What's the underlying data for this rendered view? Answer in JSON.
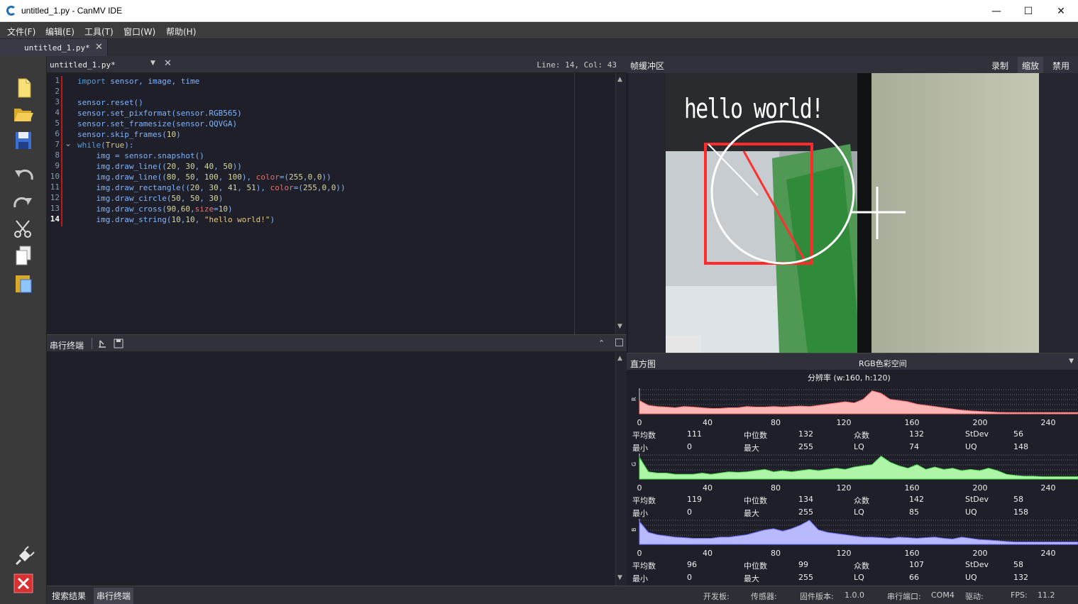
{
  "window": {
    "title": "untitled_1.py - CanMV IDE"
  },
  "menu": [
    "文件(F)",
    "编辑(E)",
    "工具(T)",
    "窗口(W)",
    "帮助(H)"
  ],
  "tab": {
    "label": "untitled_1.py*"
  },
  "editor": {
    "filename": "untitled_1.py*",
    "position": "Line: 14, Col: 43",
    "line_numbers": [
      "1",
      "2",
      "3",
      "4",
      "5",
      "6",
      "7",
      "8",
      "9",
      "10",
      "11",
      "12",
      "13",
      "14"
    ],
    "code_lines": [
      "import sensor, image, time",
      "",
      "sensor.reset()",
      "sensor.set_pixformat(sensor.RGB565)",
      "sensor.set_framesize(sensor.QQVGA)",
      "sensor.skip_frames(10)",
      "while(True):",
      "    img = sensor.snapshot()",
      "    img.draw_line((20, 30, 40, 50))",
      "    img.draw_line((80, 50, 100, 100), color=(255,0,0))",
      "    img.draw_rectangle((20, 30, 41, 51), color=(255,0,0))",
      "    img.draw_circle(50, 50, 30)",
      "    img.draw_cross(90,60,size=10)",
      "    img.draw_string(10,10, \"hello world!\")"
    ]
  },
  "terminal": {
    "title": "串行终端"
  },
  "framebuffer": {
    "title": "帧缓冲区",
    "buttons": [
      "录制",
      "缩放",
      "禁用"
    ],
    "overlay_text": "hello world!"
  },
  "histogram": {
    "title": "直方图",
    "colorspace": "RGB色彩空间",
    "resolution": "分辨率 (w:160, h:120)",
    "ticks": [
      "0",
      "40",
      "80",
      "120",
      "160",
      "200",
      "240"
    ],
    "channels": [
      {
        "axis": "R",
        "color": "#ffb6b6",
        "line": "#ff7070",
        "stats": {
          "平均数": "111",
          "中位数": "132",
          "众数": "132",
          "StDev": "56",
          "最小": "0",
          "最大": "255",
          "LQ": "74",
          "UQ": "148"
        }
      },
      {
        "axis": "G",
        "color": "#aef5a8",
        "line": "#4fd84f",
        "stats": {
          "平均数": "119",
          "中位数": "134",
          "众数": "142",
          "StDev": "58",
          "最小": "0",
          "最大": "255",
          "LQ": "85",
          "UQ": "158"
        }
      },
      {
        "axis": "B",
        "color": "#b9b9ff",
        "line": "#6f6fff",
        "stats": {
          "平均数": "96",
          "中位数": "99",
          "众数": "107",
          "StDev": "58",
          "最小": "0",
          "最大": "255",
          "LQ": "66",
          "UQ": "132"
        }
      }
    ]
  },
  "bottom": {
    "tabs": [
      "搜索结果",
      "串行终端"
    ],
    "board_label": "开发板:",
    "sensor_label": "传感器:",
    "firmware_label": "固件版本:",
    "firmware_value": "1.0.0",
    "port_label": "串行端口:",
    "port_value": "COM4",
    "driver_label": "驱动:",
    "fps_label": "FPS:",
    "fps_value": "11.2"
  },
  "colors": {
    "keyword": "#569cd6",
    "module": "#7fb4ff",
    "plain": "#dcdcdc",
    "number": "#d7d7a0",
    "string": "#e8c87a",
    "builtin": "#d9c48a"
  }
}
